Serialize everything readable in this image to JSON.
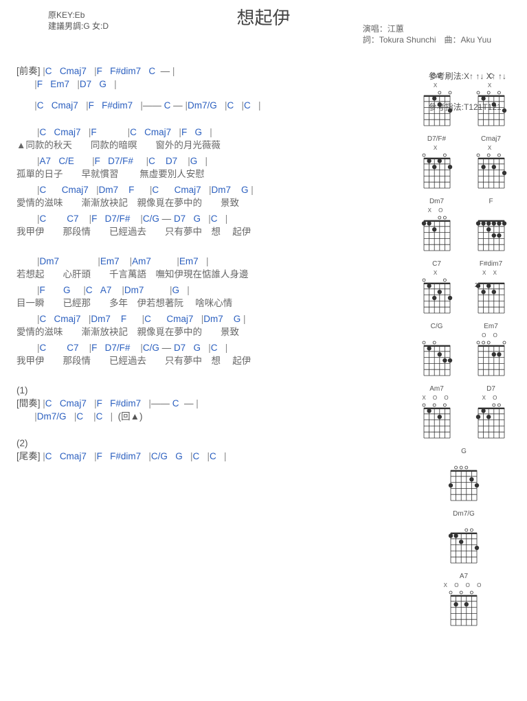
{
  "header": {
    "original_key_label": "原KEY:Eb",
    "suggest_label": "建議男調:G 女:D",
    "title": "想起伊",
    "performer_label": "演唱：江蕙",
    "credits_label": "詞：Tokura Shunchi　曲：Aku Yuu",
    "ref_strum": "參考刷法:X↑ ↑↓ X↑ ↑↓",
    "ref_finger": "參考指法:T121T121"
  },
  "sections": {
    "intro": "[前奏]",
    "interlude": "[間奏]",
    "outro": "[尾奏]",
    "marker1": "(1)",
    "marker2": "(2)",
    "repeat_marker": "(回▲)"
  },
  "chord_tokens": {
    "C": "C",
    "Cmaj7": "Cmaj7",
    "F": "F",
    "Fsdim7": "F#dim7",
    "Em7": "Em7",
    "D7": "D7",
    "G": "G",
    "Dm7": "Dm7",
    "Dm7G": "Dm7/G",
    "A7": "A7",
    "CE": "C/E",
    "D7Fs": "D7/F#",
    "C7": "C7",
    "CG": "C/G",
    "Am7": "Am7"
  },
  "lyrics": {
    "l1": "▲同款的秋天　　同款的暗暝　　窗外的月光薇薇",
    "l2": "孤單的日子　　早就慣習　　 無虛要別人安慰",
    "l3": "愛情的滋味　　漸漸放袂記　親像覓在夢中的　　景致",
    "l4": "我甲伊　　那段情　　已經過去　　只有夢中　想　 起伊",
    "l5": "若想起　　心肝頭　　千言萬語　嘸知伊現在惦誰人身邊",
    "l6": "目一瞬　　已經那　　多年　伊若想著阮　 啥咪心情",
    "l7": "愛情的滋味　　漸漸放袂記　親像覓在夢中的　　景致",
    "l8": "我甲伊　　那段情　　已經過去　　只有夢中　想　 起伊"
  },
  "chord_lines": {
    "intro1": "|C   Cmaj7   |F   F#dim7   C  — |",
    "intro2": "|F   Em7   |D7   G   |",
    "intro3": "|C   Cmaj7   |F   F#dim7   |—— C — |Dm7/G   |C   |C   |",
    "v1a": "|C   Cmaj7   |F            |C   Cmaj7   |F   G   |",
    "v1b": "|A7   C/E       |F   D7/F#     |C    D7    |G   |",
    "v1c": "|C      Cmaj7   |Dm7    F      |C      Cmaj7   |Dm7    G |",
    "v1d": "|C        C7    |F   D7/F#    |C/G — D7   G   |C   |",
    "v2a": "|Dm7               |Em7    |Am7          |Em7   |",
    "v2b": "|F       G     |C   A7    |Dm7          |G   |",
    "v2c": "|C   Cmaj7   |Dm7    F      |C      Cmaj7   |Dm7    G |",
    "v2d": "|C        C7    |F   D7/F#    |C/G — D7   G   |C   |",
    "int1": "|C   Cmaj7   |F   F#dim7   |—— C  — |",
    "int2": "|Dm7/G   |C    |C   |  (回▲)",
    "out1": "|C   Cmaj7   |F   F#dim7   |C/G   G   |C   |C   |"
  },
  "diagrams": [
    {
      "name": "C/E",
      "marks": "  X",
      "dots": [
        [
          2,
          1
        ],
        [
          3,
          2
        ],
        [
          5,
          3
        ]
      ],
      "open": [
        3,
        5
      ]
    },
    {
      "name": "C",
      "marks": "X    ",
      "dots": [
        [
          1,
          1
        ],
        [
          3,
          2
        ],
        [
          5,
          3
        ]
      ],
      "open": [
        0,
        2,
        4
      ]
    },
    {
      "name": "D7/F#",
      "marks": "   X  ",
      "dots": [
        [
          1,
          1
        ],
        [
          3,
          1
        ],
        [
          2,
          2
        ],
        [
          5,
          2
        ]
      ],
      "open": [
        0,
        4
      ]
    },
    {
      "name": "Cmaj7",
      "marks": "X   ",
      "dots": [
        [
          3,
          2
        ],
        [
          1,
          2
        ],
        [
          5,
          3
        ]
      ],
      "open": [
        0,
        2,
        4
      ]
    },
    {
      "name": "Dm7",
      "marks": "X O",
      "dots": [
        [
          0,
          1
        ],
        [
          1,
          1
        ],
        [
          2,
          2
        ]
      ],
      "open": [
        3,
        4
      ]
    },
    {
      "name": "F",
      "marks": "",
      "dots": [
        [
          0,
          1
        ],
        [
          1,
          1
        ],
        [
          2,
          1
        ],
        [
          3,
          1
        ],
        [
          4,
          1
        ],
        [
          5,
          1
        ],
        [
          2,
          2
        ],
        [
          3,
          3
        ],
        [
          4,
          3
        ]
      ],
      "open": []
    },
    {
      "name": "C7",
      "marks": "X   ",
      "dots": [
        [
          1,
          1
        ],
        [
          3,
          2
        ],
        [
          5,
          3
        ],
        [
          2,
          3
        ]
      ],
      "open": [
        0,
        4
      ]
    },
    {
      "name": "F#dim7",
      "marks": "  X X",
      "dots": [
        [
          0,
          1
        ],
        [
          2,
          1
        ],
        [
          1,
          2
        ],
        [
          3,
          2
        ]
      ],
      "open": [],
      "fret": "2"
    },
    {
      "name": "C/G",
      "marks": "",
      "dots": [
        [
          1,
          1
        ],
        [
          3,
          2
        ],
        [
          4,
          3
        ],
        [
          5,
          3
        ]
      ],
      "open": [
        0,
        2
      ]
    },
    {
      "name": "Em7",
      "marks": "O    O",
      "dots": [
        [
          4,
          2
        ],
        [
          3,
          2
        ]
      ],
      "open": [
        0,
        1,
        2,
        5
      ]
    },
    {
      "name": "Am7",
      "marks": "X O  O",
      "dots": [
        [
          1,
          1
        ],
        [
          3,
          2
        ]
      ],
      "open": [
        0,
        2,
        4
      ]
    },
    {
      "name": "D7",
      "marks": "X O",
      "dots": [
        [
          1,
          1
        ],
        [
          0,
          2
        ],
        [
          2,
          2
        ]
      ],
      "open": [
        3,
        4
      ]
    },
    {
      "name": "G",
      "marks": "",
      "dots": [
        [
          0,
          3
        ],
        [
          4,
          2
        ],
        [
          5,
          3
        ]
      ],
      "open": [
        1,
        2,
        3
      ],
      "single": true
    },
    {
      "name": "Dm7/G",
      "marks": "",
      "dots": [
        [
          0,
          1
        ],
        [
          1,
          1
        ],
        [
          2,
          2
        ],
        [
          5,
          3
        ]
      ],
      "open": [
        3,
        4
      ],
      "single": true
    },
    {
      "name": "A7",
      "marks": "X O O O",
      "dots": [
        [
          1,
          2
        ],
        [
          3,
          2
        ]
      ],
      "open": [
        0,
        2,
        4
      ],
      "single": true
    }
  ]
}
